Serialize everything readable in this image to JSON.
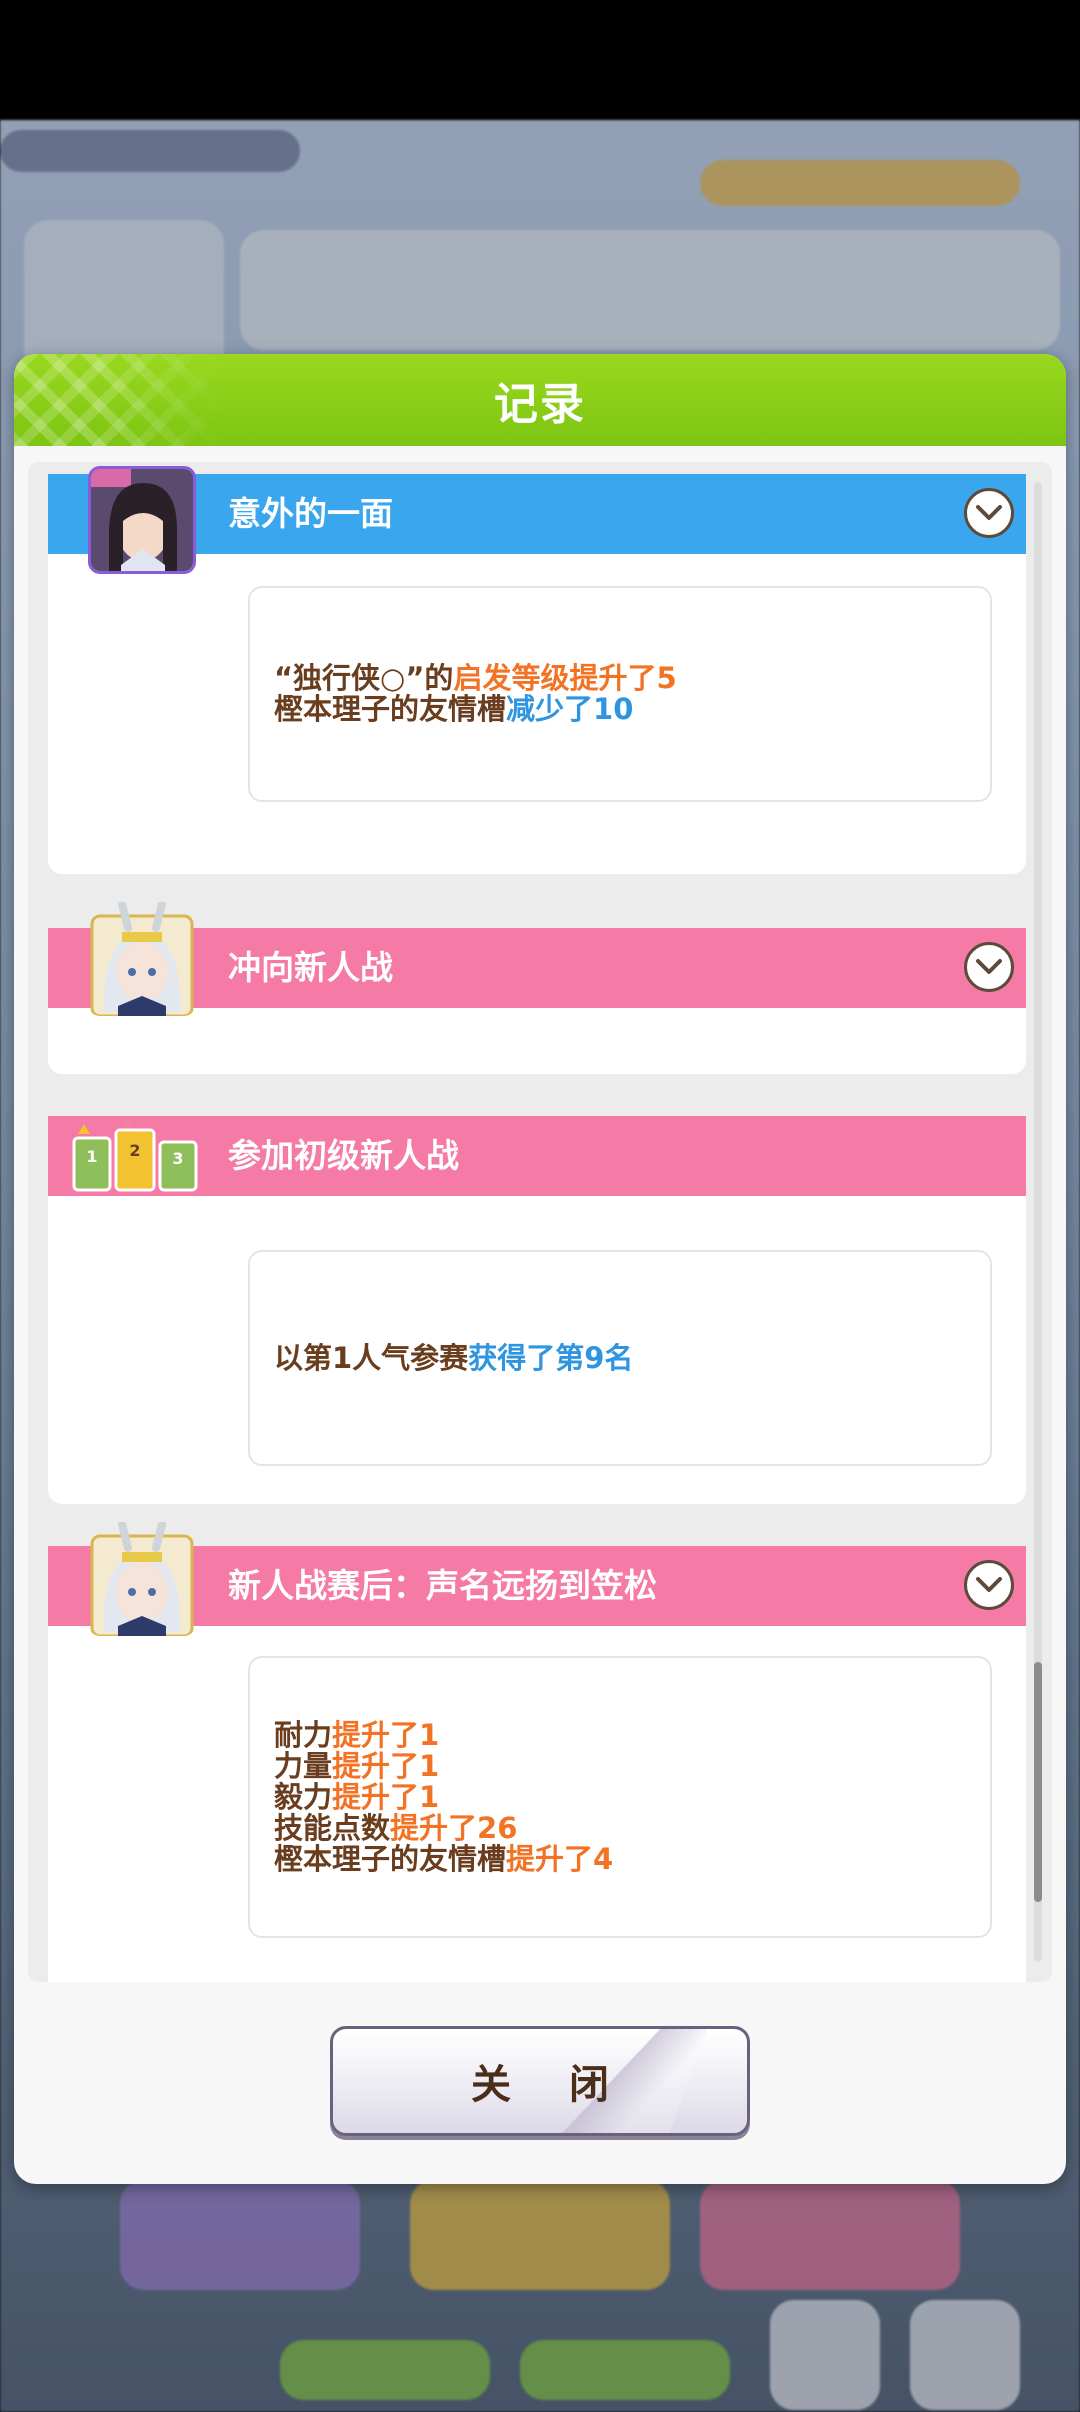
{
  "modal": {
    "title": "记录",
    "close_label": "关 闭"
  },
  "records": [
    {
      "title": "意外的一面",
      "color": "#3aa6ee",
      "expandable": true,
      "lines": [
        [
          {
            "t": "“独行侠○”的",
            "c": "brown"
          },
          {
            "t": "启发等级提升了5",
            "c": "orange"
          }
        ],
        [
          {
            "t": "樫本理子的友情槽",
            "c": "brown"
          },
          {
            "t": "减少了10",
            "c": "blue"
          }
        ]
      ]
    },
    {
      "title": "冲向新人战",
      "color": "#f57aa5",
      "expandable": true,
      "lines": []
    },
    {
      "title": "参加初级新人战",
      "color": "#f57aa5",
      "expandable": false,
      "lines": [
        [
          {
            "t": "以第1人气参赛",
            "c": "brown"
          },
          {
            "t": "获得了第9名",
            "c": "blue"
          }
        ]
      ]
    },
    {
      "title": "新人战赛后：声名远扬到笠松",
      "color": "#f57aa5",
      "expandable": true,
      "lines": [
        [
          {
            "t": "耐力",
            "c": "brown"
          },
          {
            "t": "提升了1",
            "c": "orange"
          }
        ],
        [
          {
            "t": "力量",
            "c": "brown"
          },
          {
            "t": "提升了1",
            "c": "orange"
          }
        ],
        [
          {
            "t": "毅力",
            "c": "brown"
          },
          {
            "t": "提升了1",
            "c": "orange"
          }
        ],
        [
          {
            "t": "技能点数",
            "c": "brown"
          },
          {
            "t": "提升了26",
            "c": "orange"
          }
        ],
        [
          {
            "t": "樫本理子的友情槽",
            "c": "brown"
          },
          {
            "t": "提升了4",
            "c": "orange"
          }
        ]
      ]
    }
  ],
  "colors": {
    "header_green": "#7cc512",
    "text_brown": "#6a3d1e",
    "text_orange": "#f27323",
    "text_blue": "#2f95e0"
  },
  "icons": {
    "record_1": "character-portrait-dark-hair",
    "record_2": "character-portrait-white-hair",
    "record_3": "race-ranking-icon",
    "record_4": "character-portrait-white-hair",
    "chevron": "chevron-down-icon"
  }
}
